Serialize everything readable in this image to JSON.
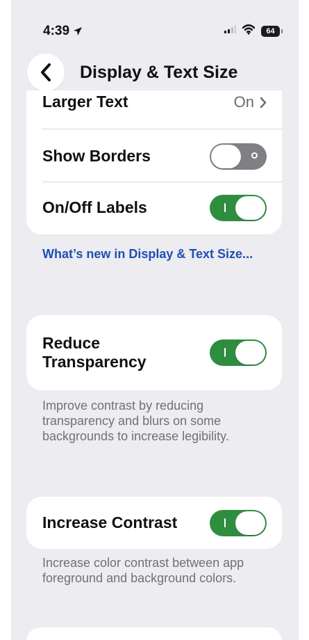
{
  "status_bar": {
    "time": "4:39",
    "battery": "64"
  },
  "nav": {
    "title": "Display & Text Size"
  },
  "settings": {
    "rows": [
      {
        "label": "Larger Text",
        "value": "On"
      },
      {
        "label": "Show Borders"
      },
      {
        "label": "On/Off Labels"
      }
    ],
    "link": "What’s new in Display & Text Size...",
    "reduce_transparency": {
      "label": "Reduce Transparency",
      "description": "Improve contrast by reducing transparency and blurs on some backgrounds to increase legibility."
    },
    "increase_contrast": {
      "label": "Increase Contrast",
      "description": "Increase color contrast between app foreground and background colors."
    }
  },
  "toggles": {
    "show_borders": false,
    "on_off_labels": true,
    "reduce_transparency": true,
    "increase_contrast": true
  },
  "colors": {
    "background": "#ececf1",
    "card": "#ffffff",
    "toggle_on": "#2f8d3f",
    "toggle_off": "#7f7f84",
    "link": "#1f4fb3",
    "secondary_text": "#707078"
  },
  "icons": {
    "status": [
      "location-icon",
      "signal-icon",
      "wifi-icon",
      "battery-icon"
    ],
    "navigation": [
      "back-chevron-icon"
    ],
    "row": [
      "chevron-right-icon"
    ]
  }
}
